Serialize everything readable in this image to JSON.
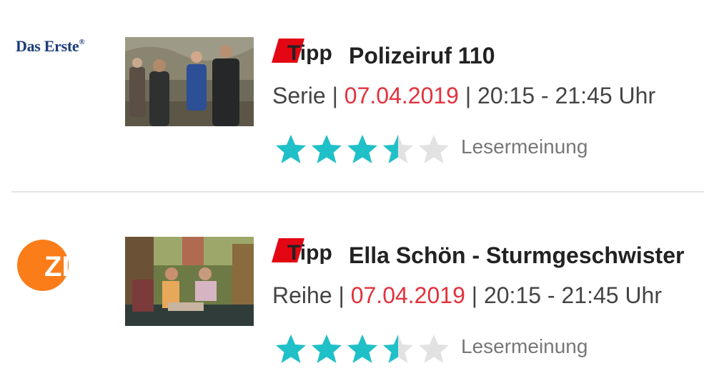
{
  "colors": {
    "accent_red": "#e2323d",
    "star_filled": "#1fc0c8",
    "star_empty": "#e2e2e2",
    "tipp_red": "#e30613"
  },
  "listings": [
    {
      "channel": "Das Erste",
      "channel_mark": "®",
      "channel_icon": "das-erste-logo",
      "badge": "Tipp",
      "title": "Polizeiruf 110",
      "type": "Serie",
      "date": "07.04.2019",
      "time": "20:15 - 21:45 Uhr",
      "rating_stars": 3.5,
      "rating_max": 5,
      "rating_label": "Lesermeinung"
    },
    {
      "channel": "ZDF",
      "channel_icon": "zdf-logo",
      "badge": "Tipp",
      "title": "Ella Schön - Sturmgeschwister",
      "type": "Reihe",
      "date": "07.04.2019",
      "time": "20:15 - 21:45 Uhr",
      "rating_stars": 3.5,
      "rating_max": 5,
      "rating_label": "Lesermeinung"
    }
  ]
}
